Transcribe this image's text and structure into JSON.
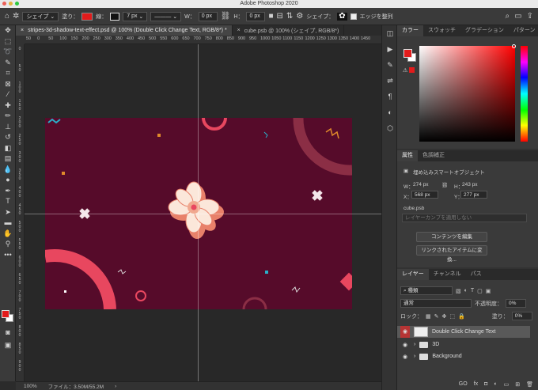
{
  "app": {
    "title": "Adobe Photoshop 2020",
    "traffic_lights": [
      "#ec5f57",
      "#e2b33b",
      "#2fc840"
    ]
  },
  "options_bar": {
    "home_icon": "home-icon",
    "tool_icon": "custom-shape-tool-icon",
    "mode": "シェイプ",
    "fill_label": "塗り：",
    "fill_color": "#e21b1b",
    "stroke_label": "線：",
    "stroke_width": "7 px",
    "w_label": "W：",
    "w_value": "0 px",
    "h_label": "H：",
    "h_value": "0 px",
    "shape_label": "シェイプ：",
    "align_edges_label": "エッジを整列"
  },
  "documents": {
    "tabs": [
      {
        "label": "stripes-3d-shadow-text-effect.psd @ 100% (Double Click Change Text, RGB/8*) *"
      },
      {
        "label": "cube.psb @ 100% (シェイプ, RGB/8*)"
      }
    ]
  },
  "ruler": {
    "ticks": [
      "50",
      "0",
      "50",
      "100",
      "150",
      "200",
      "250",
      "300",
      "350",
      "400",
      "450",
      "500",
      "550",
      "600",
      "650",
      "700",
      "750",
      "800",
      "850",
      "900",
      "950",
      "1000",
      "1050",
      "1100",
      "1150",
      "1200",
      "1250",
      "1300",
      "1350",
      "1400",
      "1450"
    ],
    "vticks": [
      "0",
      "50",
      "100",
      "150",
      "200",
      "250",
      "300",
      "350",
      "400",
      "450",
      "500",
      "550",
      "600",
      "650",
      "700",
      "750",
      "800",
      "850",
      "900"
    ]
  },
  "status": {
    "zoom": "100%",
    "file": "ファイル：3.50M/55.2M"
  },
  "panels": {
    "color_tabs": [
      "カラー",
      "スウォッチ",
      "グラデーション",
      "パターン"
    ],
    "properties_tabs": [
      "属性",
      "色調補正"
    ],
    "properties": {
      "type": "埋め込みスマートオブジェクト",
      "w_label": "W：",
      "w": "274 px",
      "h_label": "H：",
      "h": "243 px",
      "x_label": "X：",
      "x": "568 px",
      "y_label": "Y：",
      "y": "277 px",
      "source": "cube.psb",
      "comp_placeholder": "レイヤーカンプを適用しない",
      "edit_button": "コンテンツを編集",
      "convert_button": "リンクされたアイテムに変換..."
    },
    "layers_tabs": [
      "レイヤー",
      "チャンネル",
      "パス"
    ],
    "layers": {
      "filter": "種類",
      "blend": "通常",
      "opacity_label": "不透明度：",
      "opacity": "0%",
      "lock_label": "ロック：",
      "fill_label": "塗り：",
      "fill": "0%",
      "items": [
        {
          "name": "Double Click Change Text"
        },
        {
          "name": "3D"
        },
        {
          "name": "Background"
        }
      ],
      "footer": [
        "GO",
        "fx",
        "mask-icon",
        "adjust-icon",
        "folder-icon",
        "new-layer-icon",
        "trash-icon"
      ]
    }
  }
}
